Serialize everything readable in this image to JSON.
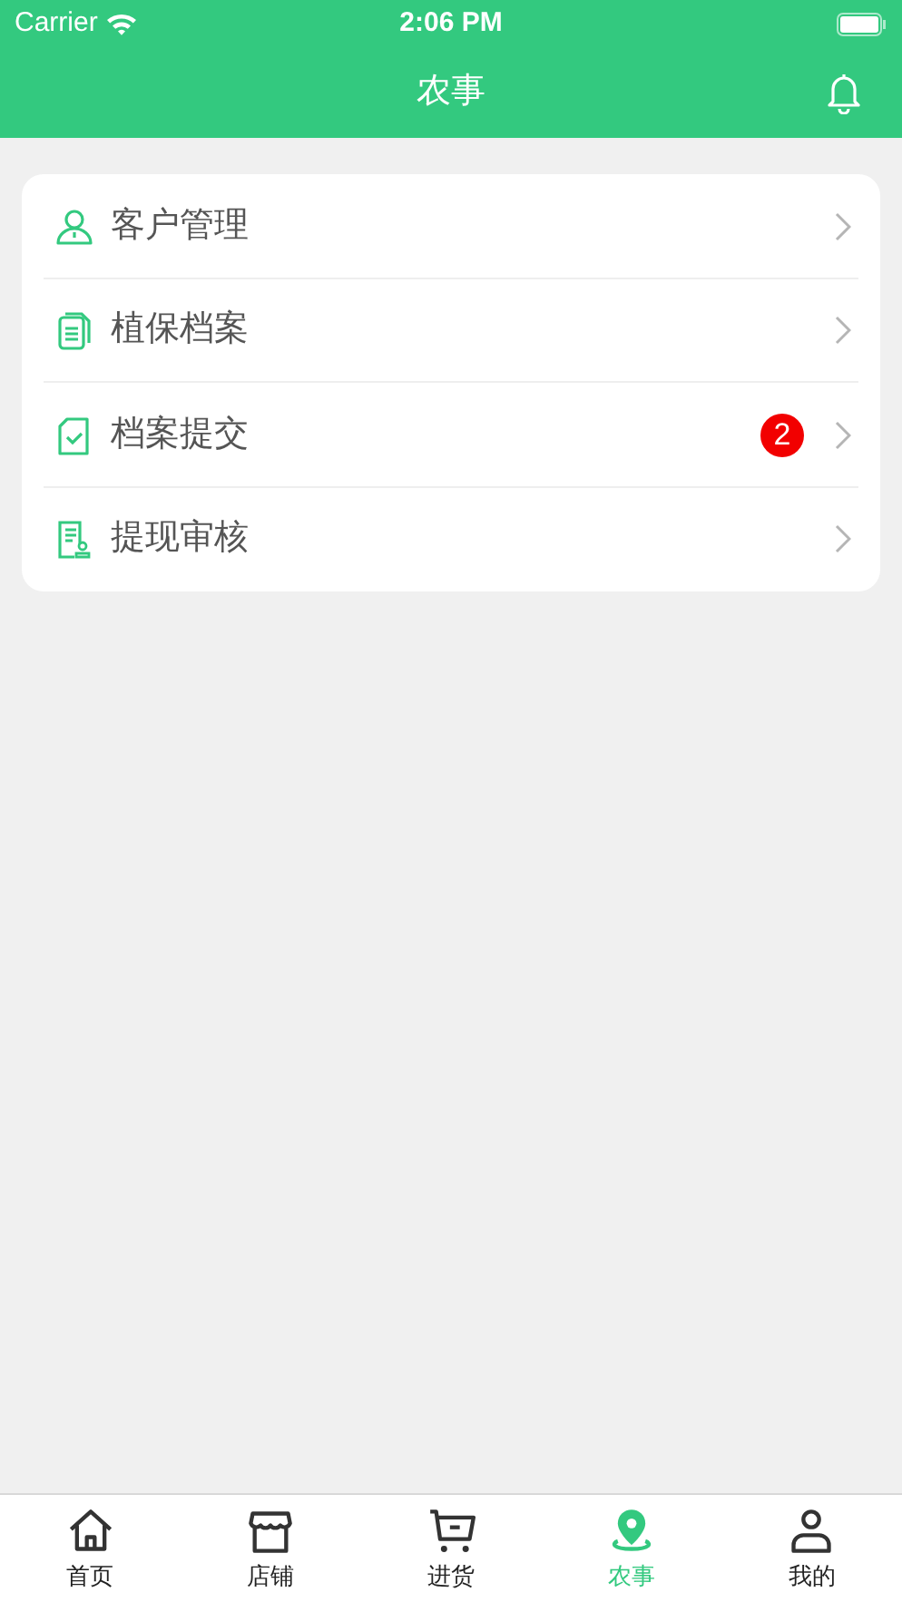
{
  "status_bar": {
    "carrier": "Carrier",
    "time": "2:06 PM"
  },
  "nav": {
    "title": "农事"
  },
  "menu": [
    {
      "label": "客户管理",
      "kind": "person"
    },
    {
      "label": "植保档案",
      "kind": "document"
    },
    {
      "label": "档案提交",
      "kind": "check",
      "badge": "2"
    },
    {
      "label": "提现审核",
      "kind": "receipt"
    }
  ],
  "tabs": [
    {
      "label": "首页",
      "kind": "home",
      "selected": false
    },
    {
      "label": "店铺",
      "kind": "store",
      "selected": false
    },
    {
      "label": "进货",
      "kind": "cart",
      "selected": false
    },
    {
      "label": "农事",
      "kind": "pin",
      "selected": true
    },
    {
      "label": "我的",
      "kind": "user",
      "selected": false
    }
  ]
}
